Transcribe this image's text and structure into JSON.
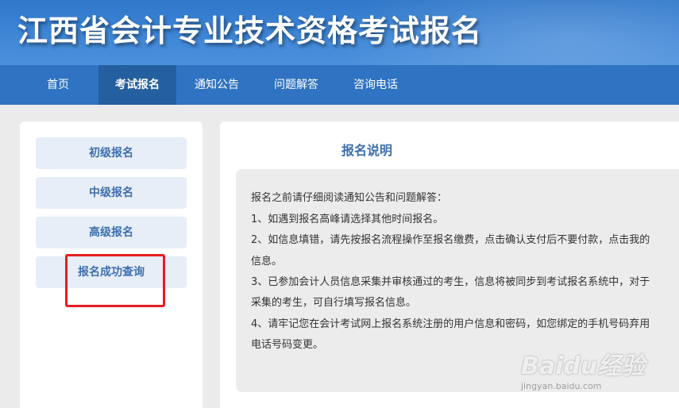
{
  "header": {
    "title": "江西省会计专业技术资格考试报名"
  },
  "nav": {
    "items": [
      {
        "label": "首页"
      },
      {
        "label": "考试报名"
      },
      {
        "label": "通知公告"
      },
      {
        "label": "问题解答"
      },
      {
        "label": "咨询电话"
      }
    ],
    "active": "考试报名"
  },
  "sidebar": {
    "items": [
      {
        "label": "初级报名"
      },
      {
        "label": "中级报名"
      },
      {
        "label": "高级报名"
      },
      {
        "label": "报名成功查询"
      }
    ]
  },
  "main": {
    "title": "报名说明",
    "lines": [
      "报名之前请仔细阅读通知公告和问题解答：",
      "1、如遇到报名高峰请选择其他时间报名。",
      "2、如信息填错，请先按报名流程操作至报名缴费，点击确认支付后不要付款，点击我的",
      "信息。",
      "3、已参加会计人员信息采集并审核通过的考生，信息将被同步到考试报名系统中，对于",
      "采集的考生，可自行填写报名信息。",
      "4、请牢记您在会计考试网上报名系统注册的用户信息和密码，如您绑定的手机号码弃用",
      "电话号码变更。"
    ]
  },
  "watermark": {
    "main": "Baidu经验",
    "sub": "jingyan.baidu.com"
  },
  "colors": {
    "header_blue": "#3f86d6",
    "nav_blue": "#2f73c2",
    "accent_text": "#3d6fae",
    "highlight_red": "#e81d1d"
  }
}
